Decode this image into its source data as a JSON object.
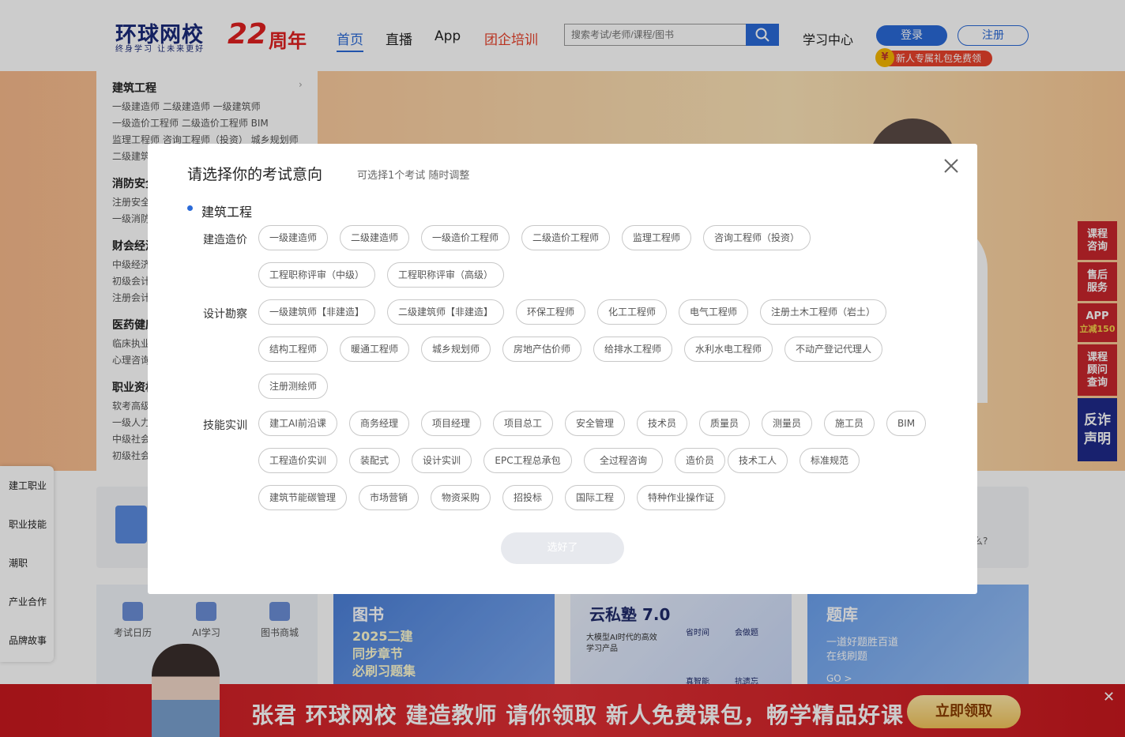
{
  "header": {
    "logo": "环球网校",
    "logo_slogan": "终身学习 让未来更好",
    "anniversary_num": "22",
    "anniversary_text": "周年",
    "nav": [
      "首页",
      "直播",
      "App",
      "团企培训"
    ],
    "search_placeholder": "搜索考试/老师/课程/图书",
    "study_center": "学习中心",
    "login": "登录",
    "register": "注册",
    "gift": "新人专属礼包免费领",
    "gift_coin": "¥"
  },
  "side_menu": [
    {
      "title": "建筑工程",
      "lines": [
        "一级建造师 二级建造师 一级建筑师",
        "一级造价工程师 二级造价工程师 BIM",
        "监理工程师 咨询工程师（投资） 城乡规划师",
        "二级建筑"
      ]
    },
    {
      "title": "消防安全",
      "lines": [
        "注册安全",
        "一级消防"
      ]
    },
    {
      "title": "财会经济",
      "lines": [
        "中级经济",
        "初级会计",
        "注册会计"
      ]
    },
    {
      "title": "医药健康",
      "lines": [
        "临床执业",
        "心理咨询"
      ]
    },
    {
      "title": "职业资格",
      "lines": [
        "软考高级",
        "一级人力",
        "中级社会",
        "初级社会"
      ]
    }
  ],
  "right_float": [
    {
      "label": "课程咨询"
    },
    {
      "label": "售后服务"
    },
    {
      "label": "APP",
      "sub": "立减150"
    },
    {
      "label": "课程顾问查询"
    },
    {
      "label": "反诈声明"
    }
  ],
  "left_float": [
    "建工职业",
    "职业技能",
    "潮职",
    "产业合作",
    "品牌故事"
  ],
  "notice_tail": "么?",
  "tools": [
    "考试日历",
    "AI学习",
    "图书商城"
  ],
  "cards": [
    {
      "title": "图书",
      "lines": [
        "2025二建",
        "同步章节",
        "必刷习题集"
      ]
    },
    {
      "title": "云私塾 7.0",
      "lines": [
        "大模型AI时代的高效",
        "学习产品"
      ],
      "features": [
        "省时间",
        "会做题",
        "真智能",
        "抗遗忘"
      ]
    },
    {
      "title": "题库",
      "lines": [
        "一道好题胜百道",
        "在线刷题"
      ],
      "cta": "GO >"
    }
  ],
  "promo": {
    "text": "张君 环球网校 建造教师 请你领取 新人免费课包，畅学精品好课",
    "button": "立即领取",
    "close": "✕"
  },
  "modal": {
    "title": "请选择你的考试意向",
    "subtitle": "可选择1个考试 随时调整",
    "group": "建筑工程",
    "rows": [
      {
        "label": "建造造价",
        "tags": [
          "一级建造师",
          "二级建造师",
          "一级造价工程师",
          "二级造价工程师",
          "监理工程师",
          "咨询工程师（投资）",
          "工程职称评审（中级）",
          "工程职称评审（高级）"
        ]
      },
      {
        "label": "设计勘察",
        "tags": [
          "一级建筑师【非建造】",
          "二级建筑师【非建造】",
          "环保工程师",
          "化工工程师",
          "电气工程师",
          "注册土木工程师（岩土）",
          "结构工程师",
          "暖通工程师",
          "城乡规划师",
          "房地产估价师",
          "给排水工程师",
          "水利水电工程师",
          "不动产登记代理人",
          "注册测绘师"
        ]
      },
      {
        "label": "技能实训",
        "tags": [
          "建工AI前沿课",
          "商务经理",
          "项目经理",
          "项目总工",
          "安全管理",
          "技术员",
          "质量员",
          "测量员",
          "施工员",
          "BIM",
          "工程造价实训",
          "装配式",
          "设计实训",
          "EPC工程总承包",
          "全过程咨询",
          "造价员",
          "技术工人",
          "标准规范",
          "建筑节能碳管理",
          "市场营销",
          "物资采购",
          "招投标",
          "国际工程",
          "特种作业操作证"
        ]
      }
    ],
    "confirm": "选好了"
  },
  "colors": {
    "accent": "#2a6ad8",
    "brand_red": "#e02020",
    "promo_red": "#c8181e",
    "fraud_blue": "#1f2a8a"
  }
}
